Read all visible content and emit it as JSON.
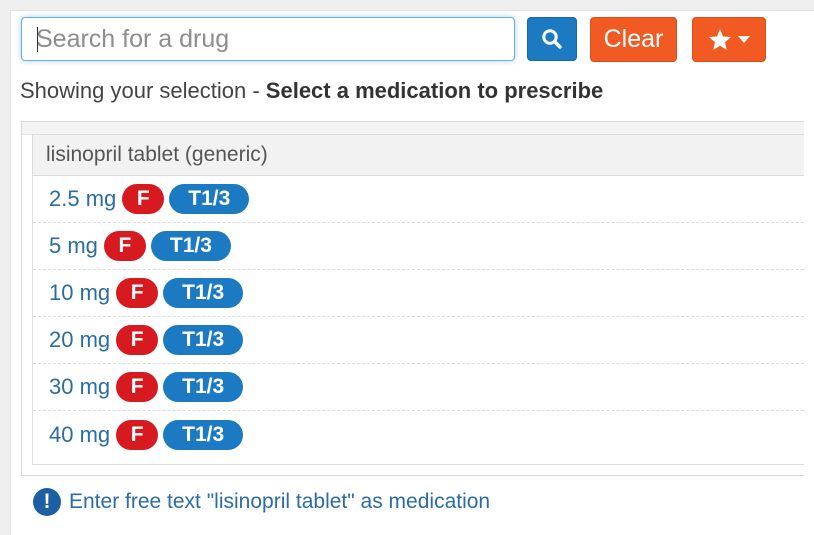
{
  "search": {
    "placeholder": "Search for a drug",
    "value": ""
  },
  "buttons": {
    "search_icon": "search-icon",
    "clear_label": "Clear",
    "favorites_icon": "star-icon",
    "favorites_caret": "caret-down-icon"
  },
  "status": {
    "prefix": "Showing your selection - ",
    "emphasis": "Select a medication to prescribe"
  },
  "group": {
    "header": "lisinopril tablet (generic)",
    "items": [
      {
        "dose": "2.5 mg",
        "formulary_badge": "F",
        "tier_badge": "T1/3"
      },
      {
        "dose": "5 mg",
        "formulary_badge": "F",
        "tier_badge": "T1/3"
      },
      {
        "dose": "10 mg",
        "formulary_badge": "F",
        "tier_badge": "T1/3"
      },
      {
        "dose": "20 mg",
        "formulary_badge": "F",
        "tier_badge": "T1/3"
      },
      {
        "dose": "30 mg",
        "formulary_badge": "F",
        "tier_badge": "T1/3"
      },
      {
        "dose": "40 mg",
        "formulary_badge": "F",
        "tier_badge": "T1/3"
      }
    ]
  },
  "footer": {
    "icon": "exclamation-circle-icon",
    "icon_glyph": "!",
    "text": "Enter free text \"lisinopril tablet\" as medication"
  },
  "colors": {
    "primary": "#1c7ac2",
    "accent": "#f15a22",
    "danger": "#d71920",
    "link": "#2b6ca3"
  }
}
